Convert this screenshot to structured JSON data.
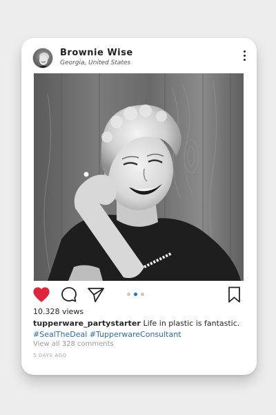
{
  "post": {
    "username": "Brownie Wise",
    "location": "Georgia, United States",
    "views": "10.328 views",
    "caption_user": "tupperware_partystarter",
    "caption_text": " Life in plastic is fantastic.",
    "hashtags": [
      "#SealTheDeal",
      "#TupperwareConsultant"
    ],
    "view_comments": "View all 328 comments",
    "timestamp": "5 DAYS AGO"
  },
  "carousel": {
    "total": 3,
    "active_index": 1
  },
  "state": {
    "liked": true
  },
  "icons": {
    "more": "more-vertical-icon",
    "like": "heart-icon",
    "comment": "comment-icon",
    "share": "share-icon",
    "save": "bookmark-icon"
  },
  "colors": {
    "heart": "#e0243b",
    "active_dot": "#1f6fd8",
    "inactive_dot": "#c7c7c7",
    "hashtag": "#2b6cb0"
  }
}
